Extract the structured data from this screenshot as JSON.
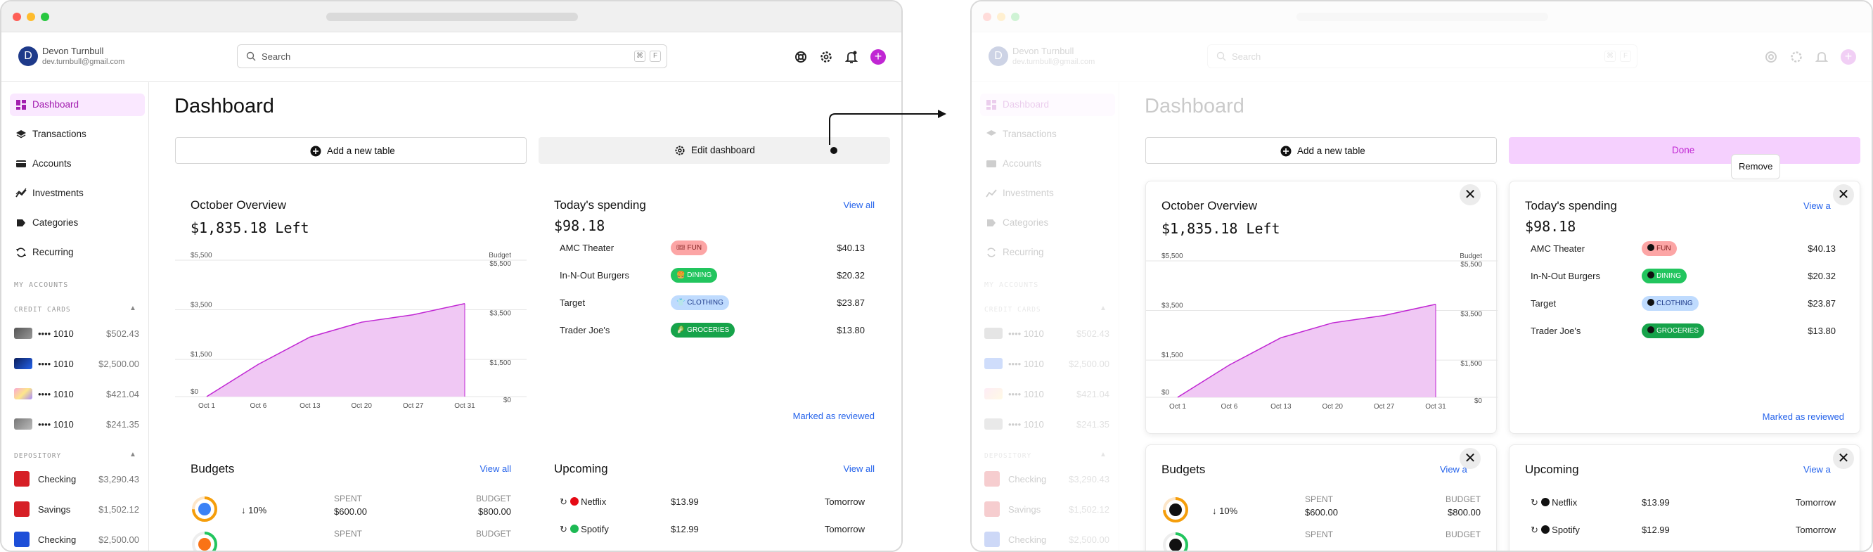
{
  "user": {
    "initial": "D",
    "name": "Devon Turnbull",
    "email": "dev.turnbull@gmail.com"
  },
  "search": {
    "placeholder": "Search",
    "key1": "⌘",
    "key2": "F"
  },
  "nav": [
    {
      "label": "Dashboard",
      "icon": "grid-icon"
    },
    {
      "label": "Transactions",
      "icon": "layers-icon"
    },
    {
      "label": "Accounts",
      "icon": "card-icon"
    },
    {
      "label": "Investments",
      "icon": "trend-icon"
    },
    {
      "label": "Categories",
      "icon": "tag-icon"
    },
    {
      "label": "Recurring",
      "icon": "refresh-icon"
    }
  ],
  "accounts": {
    "header": "MY ACCOUNTS",
    "credit_header": "CREDIT CARDS",
    "credit": [
      {
        "name": "•••• 1010",
        "balance": "$502.43"
      },
      {
        "name": "•••• 1010",
        "balance": "$2,500.00"
      },
      {
        "name": "•••• 1010",
        "balance": "$421.04"
      },
      {
        "name": "•••• 1010",
        "balance": "$241.35"
      }
    ],
    "depository_header": "DEPOSITORY",
    "depository": [
      {
        "name": "Checking",
        "balance": "$3,290.43"
      },
      {
        "name": "Savings",
        "balance": "$1,502.12"
      },
      {
        "name": "Checking",
        "balance": "$2,500.00"
      }
    ]
  },
  "page": {
    "title": "Dashboard"
  },
  "actions": {
    "add_table": "Add a new table",
    "edit_dashboard": "Edit dashboard",
    "done": "Done",
    "remove": "Remove"
  },
  "overview": {
    "title": "October Overview",
    "amount": "$1,835.18 Left",
    "budget_label": "Budget"
  },
  "spending": {
    "title": "Today's spending",
    "amount": "$98.18",
    "view_all": "View all",
    "view_all_truncated": "View a",
    "reviewed": "Marked as reviewed",
    "items": [
      {
        "merchant": "AMC Theater",
        "tag": "FUN",
        "emoji": "🎟",
        "amount": "$40.13"
      },
      {
        "merchant": "In-N-Out Burgers",
        "tag": "DINING",
        "emoji": "🍔",
        "amount": "$20.32"
      },
      {
        "merchant": "Target",
        "tag": "CLOTHING",
        "emoji": "👕",
        "amount": "$23.87"
      },
      {
        "merchant": "Trader Joe's",
        "tag": "GROCERIES",
        "emoji": "🥬",
        "amount": "$13.80"
      }
    ]
  },
  "budgets": {
    "title": "Budgets",
    "view_all": "View all",
    "view_all_truncated": "View a",
    "spent_label": "SPENT",
    "budget_label": "BUDGET",
    "rows": [
      {
        "change": "↓ 10%",
        "spent": "$600.00",
        "budget": "$800.00"
      }
    ]
  },
  "upcoming": {
    "title": "Upcoming",
    "view_all": "View all",
    "view_all_truncated": "View a",
    "items": [
      {
        "name": "Netflix",
        "amount": "$13.99",
        "when": "Tomorrow"
      },
      {
        "name": "Spotify",
        "amount": "$12.99",
        "when": "Tomorrow"
      }
    ]
  },
  "colors": {
    "accent": "#c026d3",
    "accent_soft": "#fae8ff",
    "link": "#2563eb",
    "chart_fill": "#f0c8f4",
    "chart_line": "#c026d3"
  },
  "chart_data": {
    "type": "area",
    "title": "",
    "x": [
      "Oct 1",
      "Oct 6",
      "Oct 13",
      "Oct 20",
      "Oct 27",
      "Oct 31"
    ],
    "series": [
      {
        "name": "",
        "values": [
          0,
          1300,
          2400,
          3000,
          3300,
          3750
        ]
      }
    ],
    "y_ticks_left": [
      "$5,500",
      "$3,500",
      "$1,500",
      "$0"
    ],
    "y_ticks_right": [
      "$5,500",
      "$3,500",
      "$1,500",
      "$0"
    ],
    "right_axis_label": "Budget",
    "ylim": [
      0,
      5500
    ],
    "grid": true
  }
}
